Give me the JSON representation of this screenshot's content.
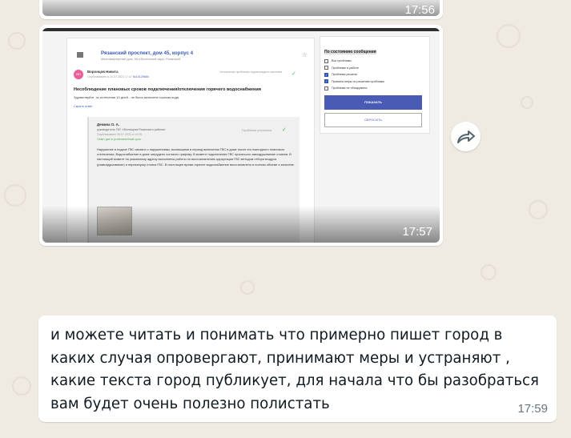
{
  "messages": {
    "prev": {
      "time": "17:56"
    },
    "image": {
      "time": "17:57",
      "screenshot": {
        "address": "Рязанский проспект, дом 45, корпус 4",
        "address_sub": "Многоквартирный дом, Юго-Восточный округ, Рязанский",
        "avatar_initials": "ВН",
        "author": "Воронцов Никита",
        "published": "Опубликовано в 24.07.2023 17:47",
        "ticket_no": "№14129684",
        "status_author": "Устранение проблемы подтверждено жителем",
        "issue_title": "Несоблюдение плановых сроков подключения/отключения горячего водоснабжения",
        "issue_text": "Здравствуйте, по истечении 10 дней - не была включена горячая вода.",
        "hide_reply": "Скрыть ответ",
        "reply_name": "Демина О. А.",
        "reply_role": "руководитель ГБУ «Жилищник Рязанского района»",
        "reply_date": "Опубликовано 26.07.2023 в 13:25",
        "reply_late": "Ответ дан в установленный срок",
        "reply_status": "Проблема устранена",
        "reply_body": "Нарушение в подаче ГВС связано с нарушениями, возникшими в период включения ГВС в доме после его ежегодного планового отключения. Водоснабжение в доме затрудено согласно графику. В момент подключения ГВС произошло завоздушивание стояков. В настоящий момент по указанному адресу выполнены работы по восстановлению циркуляции ГВС методом отбора воздуха (развоздушивание) и перезапуску стояка ГВС. В настоящее время горячее водоснабжение восстановлено в полном объеме и качестве.",
        "filter": {
          "title": "По состоянию сообщения",
          "options": [
            {
              "label": "Все проблемы",
              "checked": false
            },
            {
              "label": "Проблемы в работе",
              "checked": false
            },
            {
              "label": "Проблема решена",
              "checked": true
            },
            {
              "label": "Приняты меры по решению проблемы",
              "checked": true
            },
            {
              "label": "Проблема не обнаружена",
              "checked": false
            }
          ],
          "show_label": "ПОКАЗАТЬ",
          "reset_label": "СБРОСИТЬ"
        }
      }
    },
    "text": {
      "body": "и можете читать и понимать что примерно пишет город в каких случая опровергают, принимают меры и устраняют , какие текста город публикует, для начала что бы разобраться вам будет очень полезно полистать",
      "time": "17:59"
    }
  }
}
